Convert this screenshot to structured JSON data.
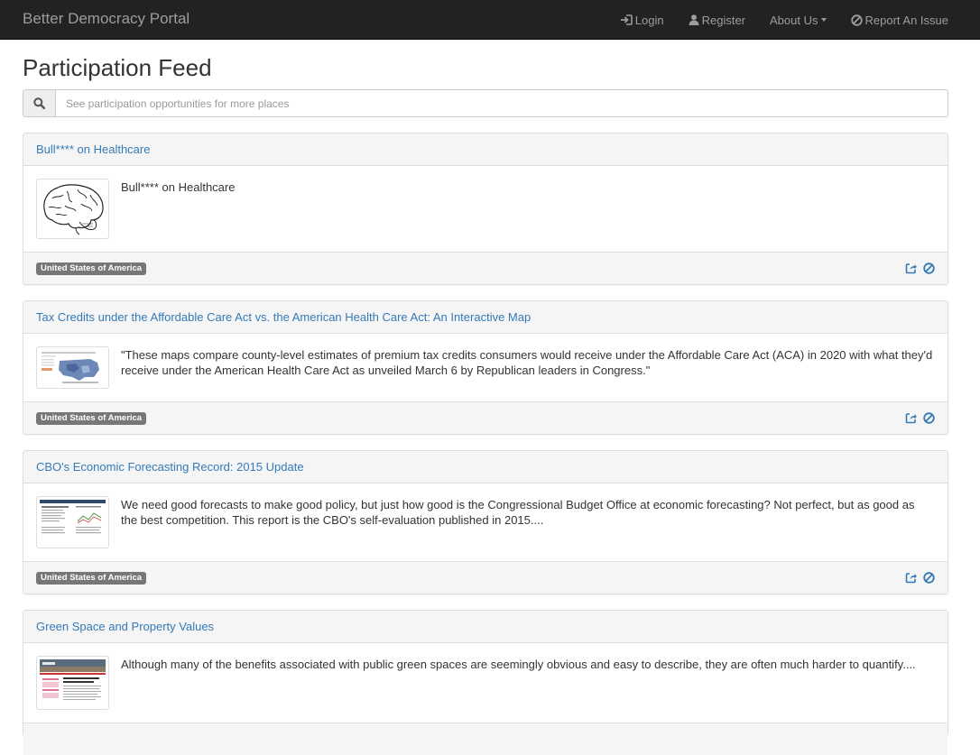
{
  "navbar": {
    "brand": "Better Democracy Portal",
    "login": "Login",
    "register": "Register",
    "about": "About Us",
    "report": "Report An Issue"
  },
  "page": {
    "title": "Participation Feed"
  },
  "search": {
    "placeholder": "See participation opportunities for more places"
  },
  "colors": {
    "link": "#337ab7",
    "navbar": "#222222",
    "label": "#777777"
  },
  "feed": [
    {
      "title": "Bull**** on Healthcare",
      "description": "Bull**** on Healthcare",
      "tag": "United States of America",
      "thumb": "brain-drawing"
    },
    {
      "title": "Tax Credits under the Affordable Care Act vs. the American Health Care Act: An Interactive Map",
      "description": "\"These maps compare county-level estimates of premium tax credits consumers would receive under the Affordable Care Act (ACA) in 2020 with what they'd receive under the American Health Care Act as unveiled March 6 by Republican leaders in Congress.\"",
      "tag": "United States of America",
      "thumb": "us-map-screenshot"
    },
    {
      "title": "CBO's Economic Forecasting Record: 2015 Update",
      "description": "We need good forecasts to make good policy, but just how good is the Congressional Budget Office at economic forecasting? Not perfect, but as good as the best competition. This report is the CBO's self-evaluation published in 2015....",
      "tag": "United States of America",
      "thumb": "report-screenshot"
    },
    {
      "title": "Green Space and Property Values",
      "description": "Although many of the benefits associated with public green spaces are seemingly obvious and easy to describe, they are often much harder to quantify....",
      "tag": "",
      "thumb": "article-screenshot"
    }
  ]
}
